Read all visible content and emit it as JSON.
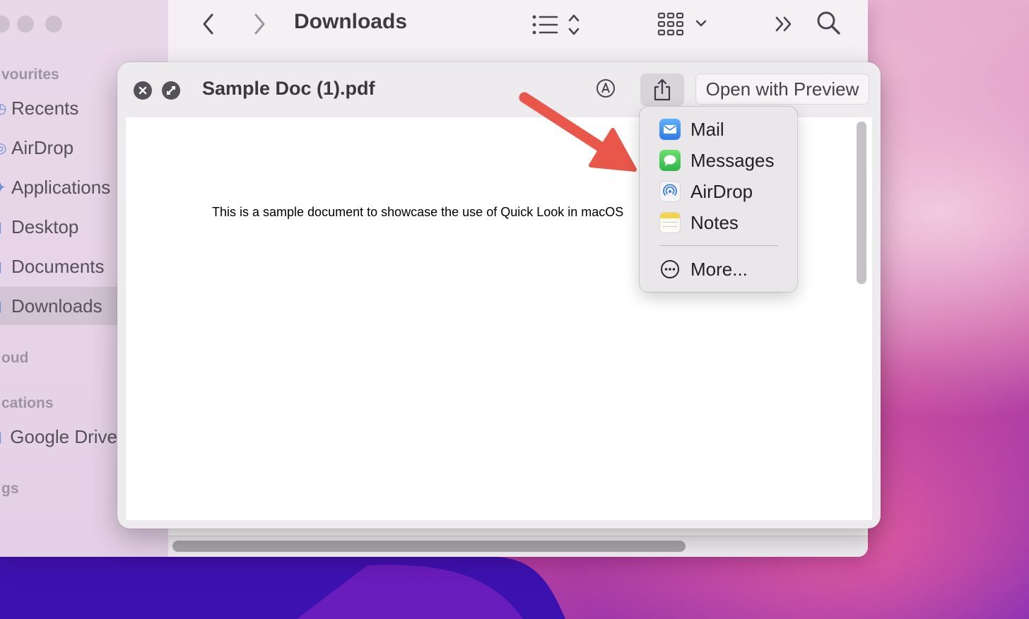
{
  "finder": {
    "title": "Downloads",
    "sidebar": {
      "sections": [
        "vourites",
        "oud",
        "cations",
        "gs"
      ],
      "items": [
        {
          "label": "Recents",
          "icon": "clock-icon"
        },
        {
          "label": "AirDrop",
          "icon": "airdrop-icon"
        },
        {
          "label": "Applications",
          "icon": "applications-icon"
        },
        {
          "label": "Desktop",
          "icon": "folder-icon"
        },
        {
          "label": "Documents",
          "icon": "folder-icon"
        },
        {
          "label": "Downloads",
          "icon": "downloads-folder-icon",
          "active": true
        }
      ],
      "location_items": [
        {
          "label": "Google Drive",
          "icon": "drive-icon"
        }
      ]
    }
  },
  "quicklook": {
    "title": "Sample Doc (1).pdf",
    "open_with_label": "Open with Preview",
    "document_text": "This is a sample document to showcase the use of Quick Look in macOS"
  },
  "share_menu": {
    "items": [
      {
        "label": "Mail",
        "icon": "mail-icon",
        "color": "#3d8ef5"
      },
      {
        "label": "Messages",
        "icon": "messages-icon",
        "color": "#34c759"
      },
      {
        "label": "AirDrop",
        "icon": "airdrop-icon",
        "color": "#4a90e2"
      },
      {
        "label": "Notes",
        "icon": "notes-icon",
        "color": "#f5d34a"
      }
    ],
    "more_label": "More..."
  },
  "colors": {
    "annotation_arrow": "#e8574a",
    "sidebar_accent": "#5b7fd0"
  }
}
